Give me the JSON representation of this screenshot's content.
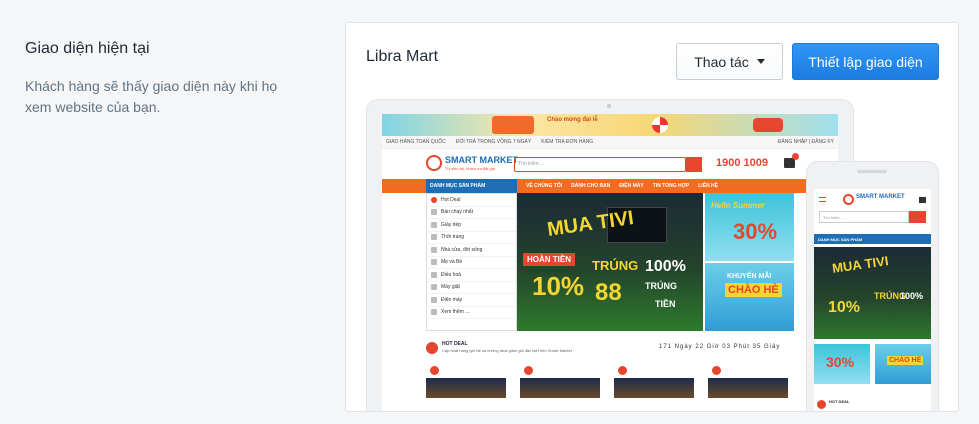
{
  "section": {
    "title": "Giao diện hiện tại",
    "description": "Khách hàng sẽ thấy giao diện này khi họ xem website của bạn."
  },
  "theme": {
    "name": "Libra Mart",
    "actions_label": "Thao tác",
    "setup_label": "Thiết lập giao diện"
  },
  "preview": {
    "banner_text": "Chào mừng đại lễ",
    "topbar": [
      "GIAO HÀNG TOÀN QUỐC",
      "ĐỔI TRẢ TRONG VÒNG 7 NGÀY",
      "KIỂM TRA ĐƠN HÀNG"
    ],
    "topbar_right": "ĐĂNG NHẬP | ĐĂNG KÝ",
    "logo": "SMART MARKET",
    "logo_tagline": "Từ siêu thị, nhiều ưu đãi giá",
    "search_placeholder": "Tìm kiếm ...",
    "phone": "1900 1009",
    "cart_count": "0",
    "category_header": "DANH MỤC SẢN PHẨM",
    "nav": [
      "VỀ CHÚNG TÔI",
      "DÀNH CHO BẠN",
      "ĐIỆN MÁY",
      "TIN TỔNG HỢP",
      "LIÊN HỆ"
    ],
    "menu": [
      "Hot Deal",
      "Bán chạy nhất",
      "Giày dép",
      "Thời trang",
      "Nhà cửa, đời sống",
      "Mẹ và Bé",
      "Điều hoà",
      "Máy giặt",
      "Điện máy",
      "Xem thêm ..."
    ],
    "hero": {
      "line1": "MUA TIVI",
      "line2": "HOÀN TIỀN",
      "line3": "10%",
      "line4": "TRÚNG",
      "line5": "88",
      "line6": "100%",
      "line7": "TRÚNG",
      "line8": "TIỀN"
    },
    "side_banner_1": {
      "caption": "Hello Summer",
      "value": "30%"
    },
    "side_banner_2": {
      "caption": "KHUYẾN MÃI",
      "value": "CHÀO HÈ"
    },
    "hot_deal_title": "HOT DEAL",
    "hot_deal_subtitle": "Cập nhật hàng giờ tất cả những deal giảm giá đặc biệt trên Smart Market",
    "countdown": "171 Ngày 22 Giờ 03 Phút 35 Giây",
    "mobile_category": "DANH MỤC SẢN PHẨM",
    "mobile_logo": "SMART MARKET",
    "mobile_search": "Tìm kiếm ...",
    "mobile_hero": [
      "MUA TIVI",
      "10%",
      "TRÚNG",
      "100%"
    ],
    "mobile_banner_1": "30%",
    "mobile_banner_2": "CHÀO HÈ",
    "mobile_hot_deal": "HOT DEAL"
  },
  "colors": {
    "primary_button": "#1c7ce0",
    "brand_orange": "#f26b21",
    "brand_blue": "#1f6db5",
    "brand_red": "#e5462d"
  }
}
